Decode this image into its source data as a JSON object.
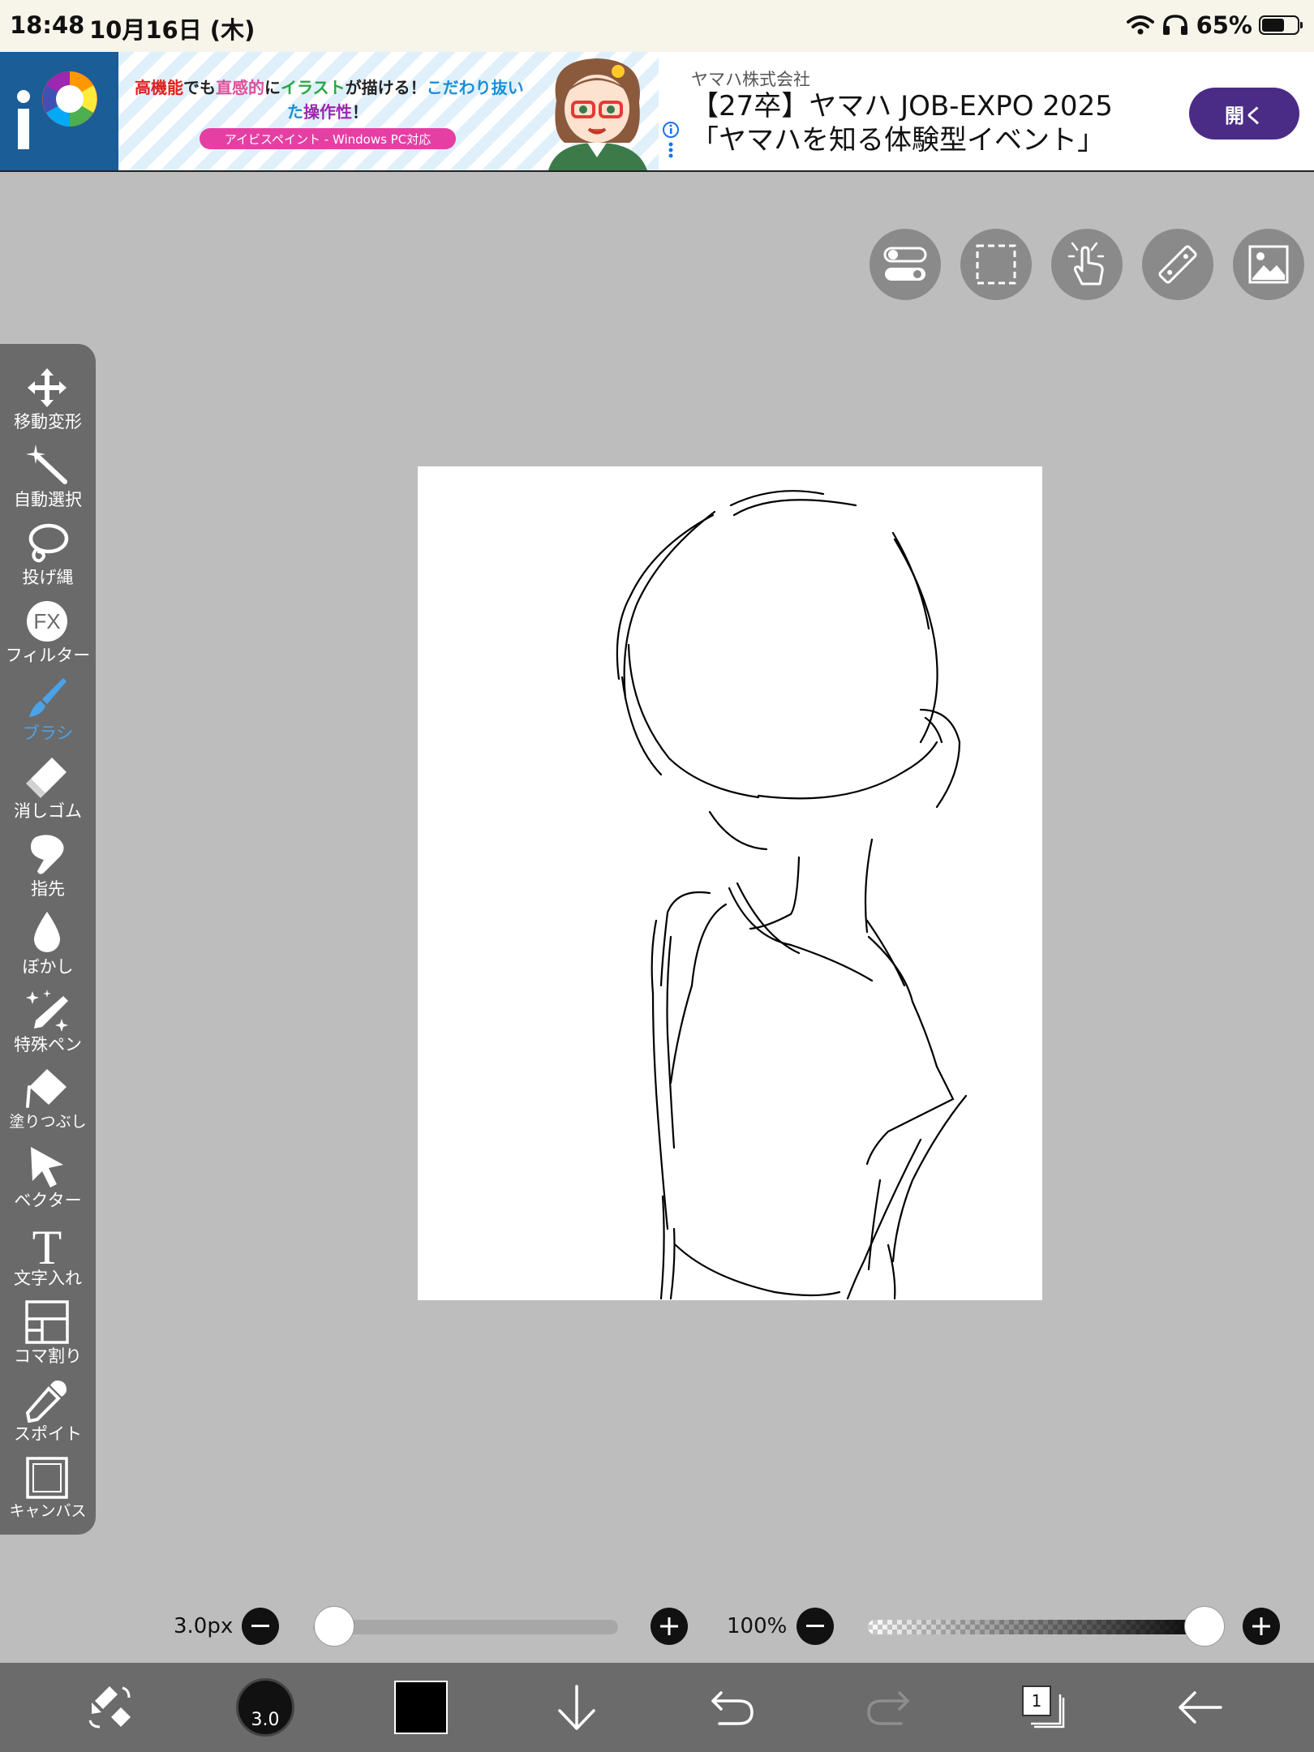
{
  "status_bar": {
    "time": "18:48",
    "date": "10月16日 (木)",
    "battery_percent": "65%",
    "battery_level": 0.65
  },
  "ad": {
    "image_line1": [
      "高機能",
      "でも",
      "直感的",
      "に",
      "イラスト",
      "が描ける！",
      "こだわり抜い"
    ],
    "image_line2": [
      "た",
      "操作性",
      "！"
    ],
    "image_pill": "アイビスペイント - Windows PC対応",
    "sponsor": "ヤマハ株式会社",
    "headline1": "【27卒】ヤマハ JOB-EXPO 2025",
    "headline2": "「ヤマハを知る体験型イベント」",
    "open_label": "開く"
  },
  "top_tools": [
    "toggle-icon",
    "selection-icon",
    "touch-icon",
    "ruler-icon",
    "image-icon"
  ],
  "left_toolbar": {
    "items": [
      {
        "id": "move",
        "label": "移動変形",
        "icon": "move-icon"
      },
      {
        "id": "magic",
        "label": "自動選択",
        "icon": "magic-wand-icon"
      },
      {
        "id": "lasso",
        "label": "投げ縄",
        "icon": "lasso-icon"
      },
      {
        "id": "filter",
        "label": "フィルター",
        "icon": "fx-icon",
        "icon_text": "FX"
      },
      {
        "id": "brush",
        "label": "ブラシ",
        "icon": "brush-icon",
        "active": true
      },
      {
        "id": "eraser",
        "label": "消しゴム",
        "icon": "eraser-icon"
      },
      {
        "id": "smudge",
        "label": "指先",
        "icon": "finger-icon"
      },
      {
        "id": "blur",
        "label": "ぼかし",
        "icon": "drop-icon"
      },
      {
        "id": "special",
        "label": "特殊ペン",
        "icon": "special-pen-icon"
      },
      {
        "id": "fill",
        "label": "塗りつぶし",
        "icon": "fill-icon"
      },
      {
        "id": "vector",
        "label": "ベクター",
        "icon": "arrow-cursor-icon"
      },
      {
        "id": "text",
        "label": "文字入れ",
        "icon": "text-icon",
        "icon_text": "T"
      },
      {
        "id": "frame",
        "label": "コマ割り",
        "icon": "frame-icon"
      },
      {
        "id": "eyedrop",
        "label": "スポイト",
        "icon": "eyedropper-icon"
      },
      {
        "id": "canvas",
        "label": "キャンバス",
        "icon": "canvas-icon"
      }
    ]
  },
  "controls": {
    "size_label": "3.0px",
    "size_value": 3.0,
    "opacity_label": "100%",
    "opacity_value": 1.0,
    "minus": "−",
    "plus": "+"
  },
  "bottom_bar": {
    "brush_size": "3.0",
    "color": "#000000",
    "layer_count": "1",
    "icons": [
      "swap-tools-icon",
      "brush-size-icon",
      "color-swatch",
      "download-icon",
      "undo-icon",
      "redo-icon",
      "layers-icon",
      "back-icon"
    ]
  }
}
